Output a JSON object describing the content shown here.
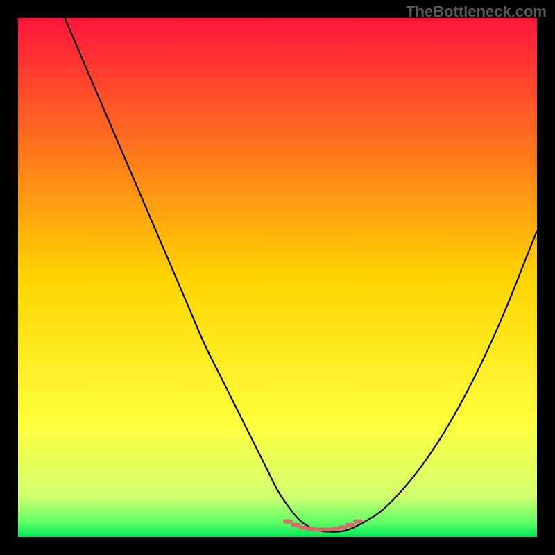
{
  "watermark": "TheBottleneck.com",
  "chart_data": {
    "type": "line",
    "title": "",
    "xlabel": "",
    "ylabel": "",
    "xlim": [
      0,
      100
    ],
    "ylim": [
      0,
      100
    ],
    "gradient_stops": [
      {
        "offset": 0.0,
        "color": "#ff153b"
      },
      {
        "offset": 0.5,
        "color": "#ffd400"
      },
      {
        "offset": 0.78,
        "color": "#ffff3d"
      },
      {
        "offset": 0.92,
        "color": "#d4ff70"
      },
      {
        "offset": 0.97,
        "color": "#66ff66"
      },
      {
        "offset": 1.0,
        "color": "#00e85c"
      }
    ],
    "series": [
      {
        "name": "curve",
        "color": "#000000",
        "x": [
          9,
          12,
          15,
          18,
          21,
          24,
          27,
          30,
          33,
          36,
          39,
          42,
          45,
          48,
          50,
          52,
          54,
          56,
          58,
          60,
          63,
          66,
          70,
          74,
          78,
          82,
          86,
          90,
          94,
          98,
          100
        ],
        "y": [
          100,
          93,
          86,
          79,
          72,
          65,
          58,
          51,
          44,
          37,
          31,
          25,
          19,
          13,
          9,
          6,
          3.5,
          2,
          1.2,
          1.0,
          1.2,
          2.5,
          5,
          9,
          14,
          20,
          27,
          35,
          44,
          54,
          59
        ]
      },
      {
        "name": "optimal-range",
        "color": "#d96a6a",
        "x": [
          52,
          53.5,
          55,
          56.5,
          58,
          59.5,
          61,
          62.5,
          64,
          65.5
        ],
        "y": [
          3.0,
          2.3,
          1.8,
          1.5,
          1.4,
          1.4,
          1.5,
          1.8,
          2.3,
          3.0
        ]
      }
    ]
  }
}
